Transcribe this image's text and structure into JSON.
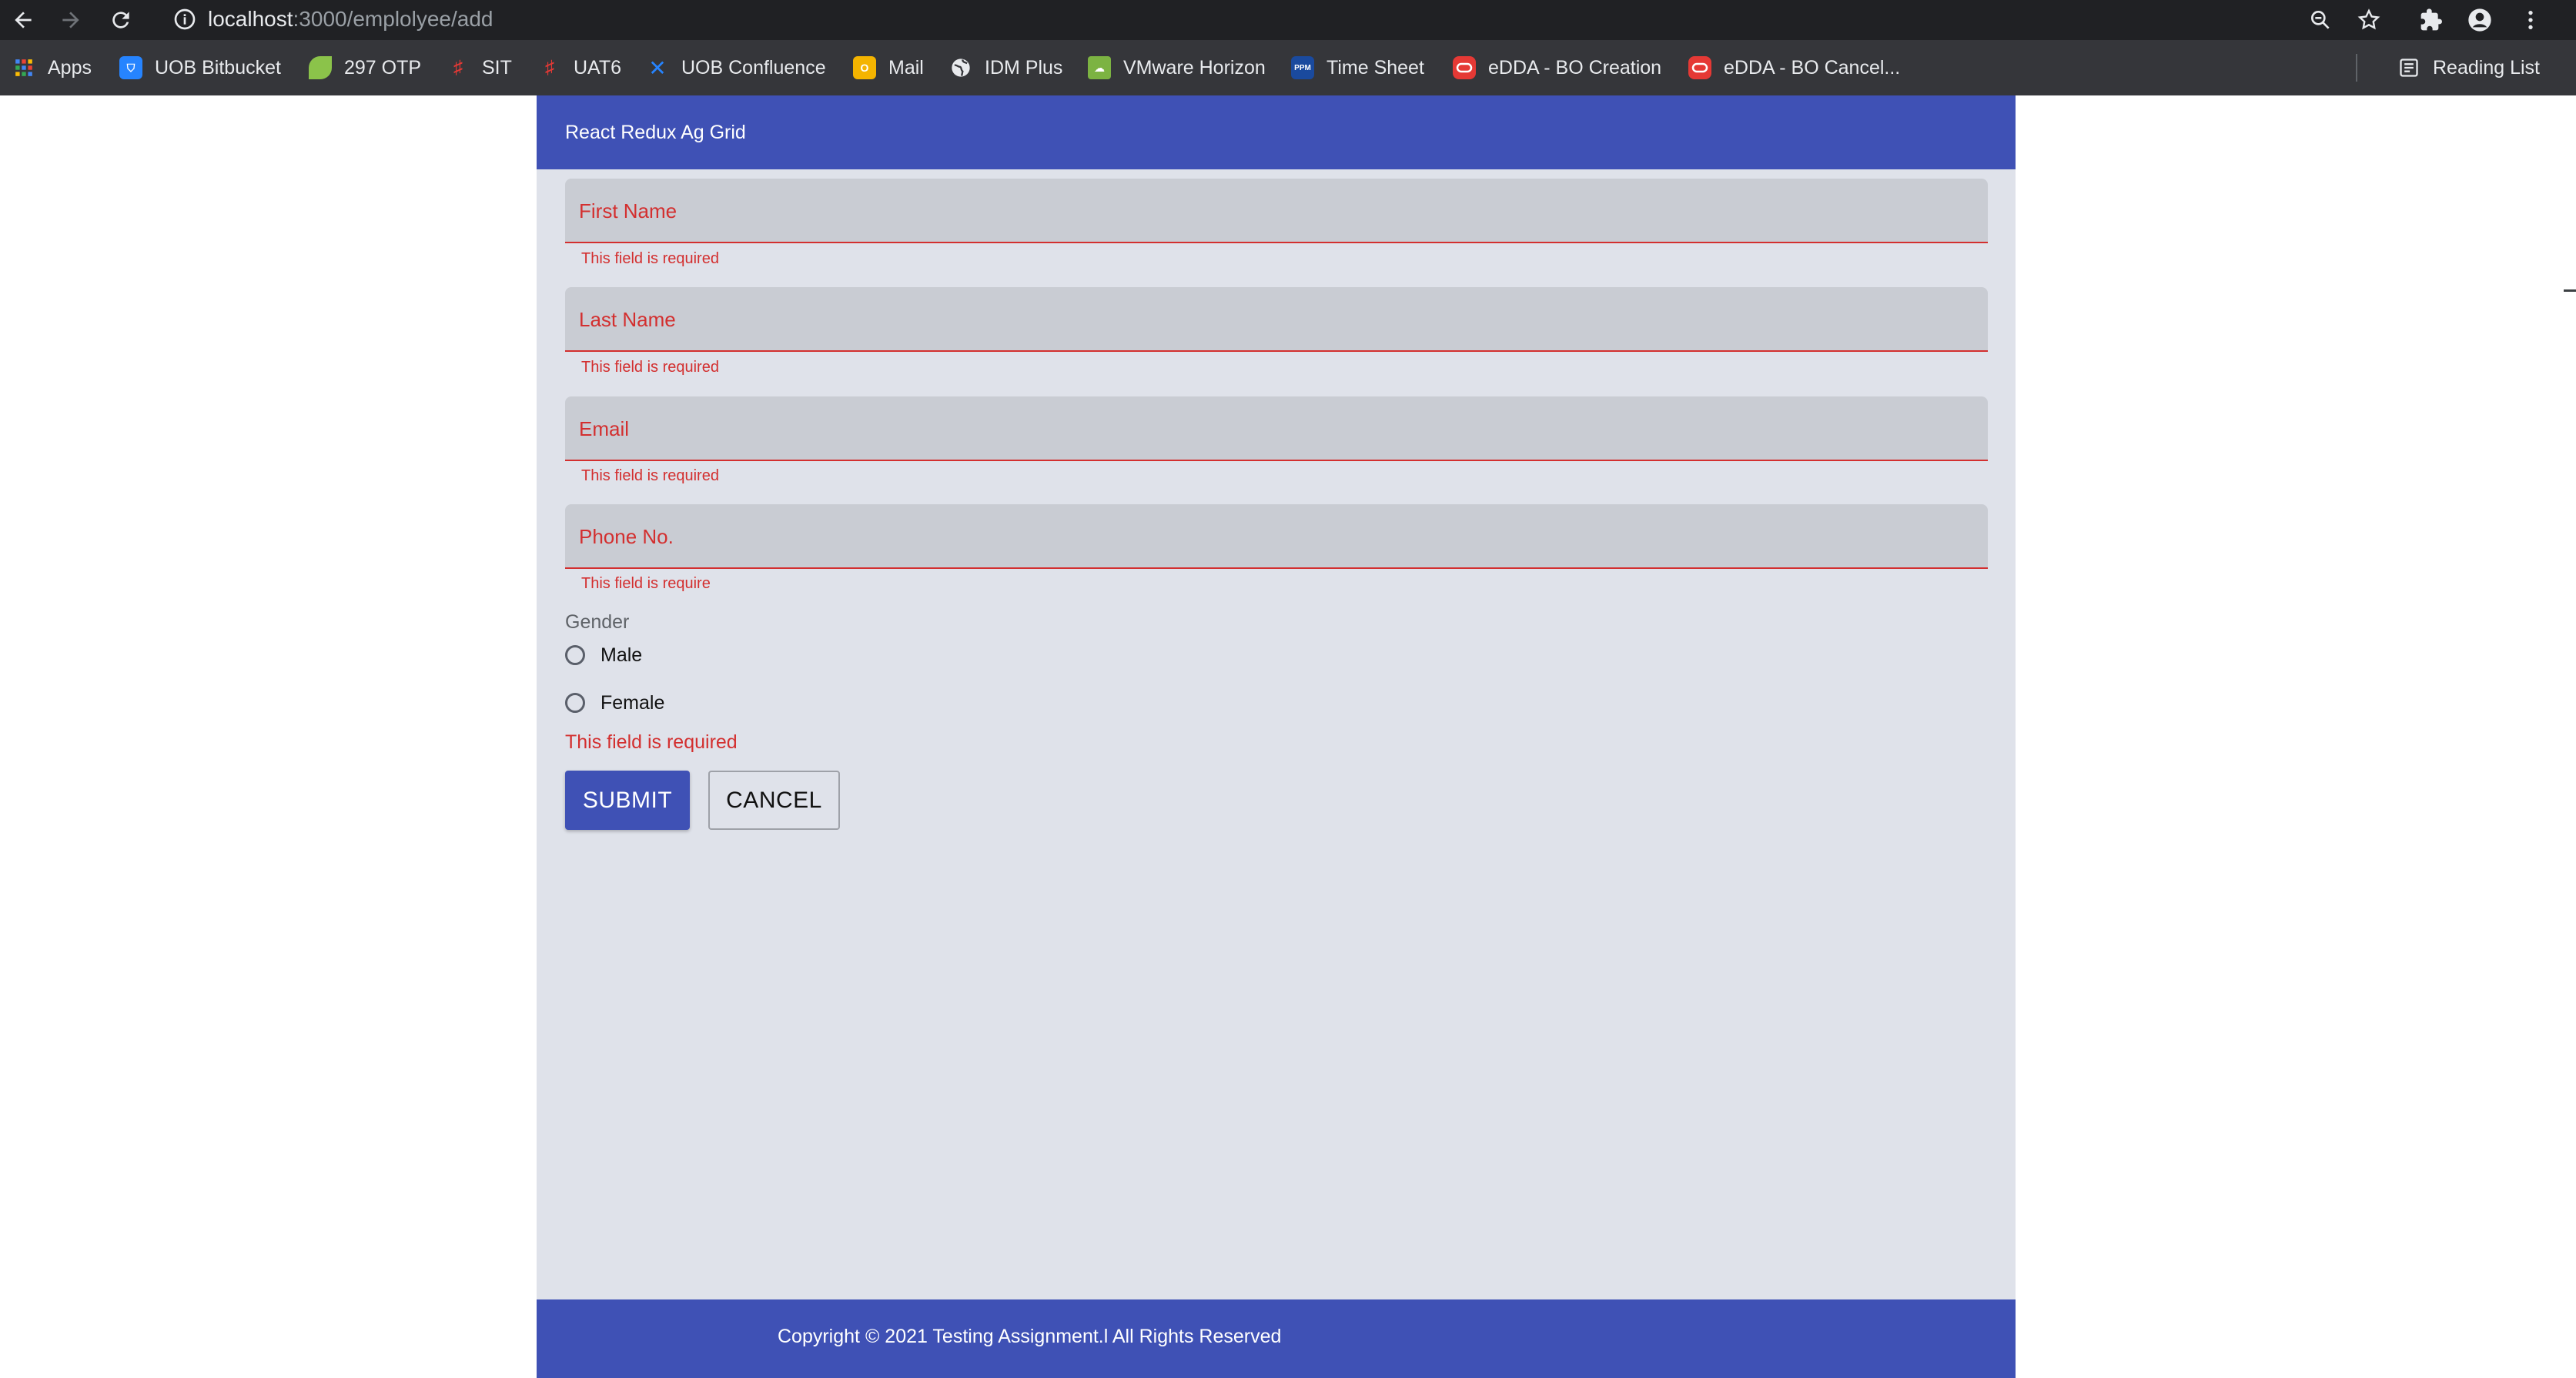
{
  "browser": {
    "url_host": "localhost",
    "url_path": ":3000/emplolyee/add",
    "bookmarks": [
      {
        "label": "Apps",
        "icon": "apps-grid-icon",
        "color": "#4285f4"
      },
      {
        "label": "UOB Bitbucket",
        "icon": "bitbucket-icon",
        "color": "#2684ff"
      },
      {
        "label": "297 OTP",
        "icon": "leaf-icon",
        "color": "#8bc34a"
      },
      {
        "label": "SIT",
        "icon": "fence-icon",
        "color": "#e53935"
      },
      {
        "label": "UAT6",
        "icon": "fence-icon",
        "color": "#e53935"
      },
      {
        "label": "UOB Confluence",
        "icon": "confluence-icon",
        "color": "#2684ff"
      },
      {
        "label": "Mail",
        "icon": "mail-icon",
        "color": "#f4b400"
      },
      {
        "label": "IDM Plus",
        "icon": "globe-icon",
        "color": "#e8eaed"
      },
      {
        "label": "VMware Horizon",
        "icon": "vmware-icon",
        "color": "#7cb342"
      },
      {
        "label": "Time Sheet",
        "icon": "ppm-icon",
        "color": "#1a4a9e"
      },
      {
        "label": "eDDA - BO Creation",
        "icon": "oracle-icon",
        "color": "#e53935"
      },
      {
        "label": "eDDA - BO Cancel...",
        "icon": "oracle-icon",
        "color": "#e53935"
      }
    ],
    "reading_list": "Reading List"
  },
  "app": {
    "title": "React Redux Ag Grid",
    "primary_color": "#3f51b5",
    "error_color": "#d32f2f",
    "form": {
      "fields": [
        {
          "label": "First Name",
          "helper": "This field is required"
        },
        {
          "label": "Last Name",
          "helper": "This field is required"
        },
        {
          "label": "Email",
          "helper": "This field is required"
        },
        {
          "label": "Phone No.",
          "helper": "This field is require"
        }
      ],
      "gender": {
        "label": "Gender",
        "options": [
          "Male",
          "Female"
        ],
        "error": "This field is required"
      },
      "submit_label": "SUBMIT",
      "cancel_label": "CANCEL"
    },
    "footer": "Copyright © 2021 Testing Assignment.l All Rights Reserved"
  }
}
